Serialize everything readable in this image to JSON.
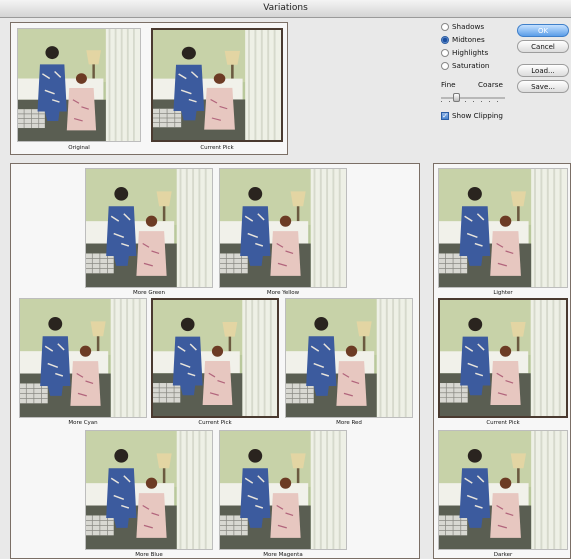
{
  "window": {
    "title": "Variations"
  },
  "preview": {
    "original_label": "Original",
    "current_pick_label": "Current Pick"
  },
  "options": {
    "radio_items": [
      {
        "label": "Shadows",
        "selected": false
      },
      {
        "label": "Midtones",
        "selected": true
      },
      {
        "label": "Highlights",
        "selected": false
      },
      {
        "label": "Saturation",
        "selected": false
      }
    ],
    "fine_label": "Fine",
    "coarse_label": "Coarse",
    "show_clipping_label": "Show Clipping",
    "show_clipping_checked": true
  },
  "buttons": {
    "ok": "OK",
    "cancel": "Cancel",
    "load": "Load...",
    "save": "Save..."
  },
  "color_grid": {
    "more_green": "More Green",
    "more_yellow": "More Yellow",
    "more_cyan": "More Cyan",
    "current_pick": "Current Pick",
    "more_red": "More Red",
    "more_blue": "More Blue",
    "more_magenta": "More Magenta"
  },
  "brightness": {
    "lighter": "Lighter",
    "current_pick": "Current Pick",
    "darker": "Darker"
  },
  "colors": {
    "accent": "#5c9ee8",
    "panel_border": "#7b6f66"
  }
}
